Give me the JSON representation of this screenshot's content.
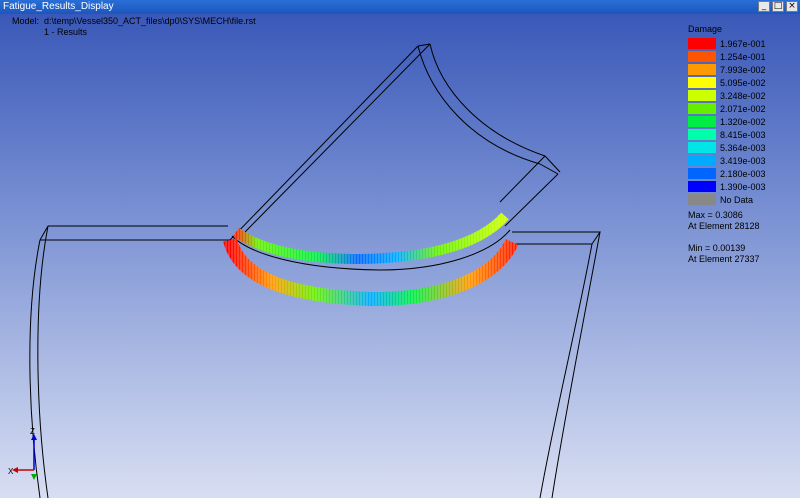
{
  "window": {
    "title": "Fatigue_Results_Display",
    "buttons": [
      "_",
      "□",
      "×"
    ]
  },
  "model": {
    "label": "Model:",
    "path": "d:\\temp\\Vessel350_ACT_files\\dp0\\SYS\\MECH\\file.rst",
    "result": "1 - Results"
  },
  "legend": {
    "title": "Damage",
    "entries": [
      {
        "color": "#ff0000",
        "label": "1.967e-001"
      },
      {
        "color": "#ff5500",
        "label": "1.254e-001"
      },
      {
        "color": "#ff9900",
        "label": "7.993e-002"
      },
      {
        "color": "#ffff00",
        "label": "5.095e-002"
      },
      {
        "color": "#ccff00",
        "label": "3.248e-002"
      },
      {
        "color": "#66ee00",
        "label": "2.071e-002"
      },
      {
        "color": "#00ee44",
        "label": "1.320e-002"
      },
      {
        "color": "#00ffaa",
        "label": "8.415e-003"
      },
      {
        "color": "#00e6e6",
        "label": "5.364e-003"
      },
      {
        "color": "#00aaff",
        "label": "3.419e-003"
      },
      {
        "color": "#0066ff",
        "label": "2.180e-003"
      },
      {
        "color": "#0000ff",
        "label": "1.390e-003"
      },
      {
        "color": "#888888",
        "label": "No Data"
      }
    ],
    "max_label": "Max = 0.3086",
    "max_element": "At Element 28128",
    "min_label": "Min = 0.00139",
    "min_element": "At Element 27337"
  },
  "triad": {
    "z": "Z",
    "x": "X"
  }
}
